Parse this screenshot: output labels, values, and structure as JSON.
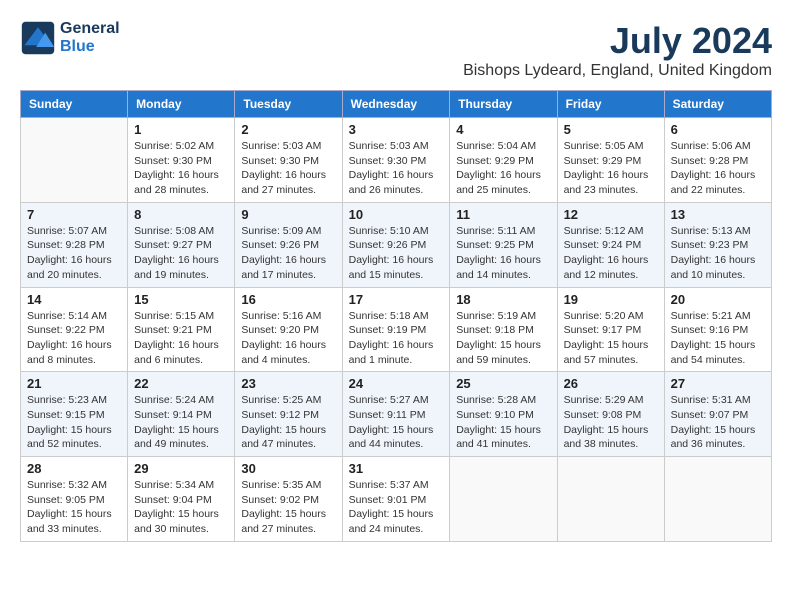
{
  "header": {
    "logo_line1": "General",
    "logo_line2": "Blue",
    "main_title": "July 2024",
    "subtitle": "Bishops Lydeard, England, United Kingdom"
  },
  "days_of_week": [
    "Sunday",
    "Monday",
    "Tuesday",
    "Wednesday",
    "Thursday",
    "Friday",
    "Saturday"
  ],
  "weeks": [
    [
      {
        "day": "",
        "info": ""
      },
      {
        "day": "1",
        "info": "Sunrise: 5:02 AM\nSunset: 9:30 PM\nDaylight: 16 hours\nand 28 minutes."
      },
      {
        "day": "2",
        "info": "Sunrise: 5:03 AM\nSunset: 9:30 PM\nDaylight: 16 hours\nand 27 minutes."
      },
      {
        "day": "3",
        "info": "Sunrise: 5:03 AM\nSunset: 9:30 PM\nDaylight: 16 hours\nand 26 minutes."
      },
      {
        "day": "4",
        "info": "Sunrise: 5:04 AM\nSunset: 9:29 PM\nDaylight: 16 hours\nand 25 minutes."
      },
      {
        "day": "5",
        "info": "Sunrise: 5:05 AM\nSunset: 9:29 PM\nDaylight: 16 hours\nand 23 minutes."
      },
      {
        "day": "6",
        "info": "Sunrise: 5:06 AM\nSunset: 9:28 PM\nDaylight: 16 hours\nand 22 minutes."
      }
    ],
    [
      {
        "day": "7",
        "info": "Sunrise: 5:07 AM\nSunset: 9:28 PM\nDaylight: 16 hours\nand 20 minutes."
      },
      {
        "day": "8",
        "info": "Sunrise: 5:08 AM\nSunset: 9:27 PM\nDaylight: 16 hours\nand 19 minutes."
      },
      {
        "day": "9",
        "info": "Sunrise: 5:09 AM\nSunset: 9:26 PM\nDaylight: 16 hours\nand 17 minutes."
      },
      {
        "day": "10",
        "info": "Sunrise: 5:10 AM\nSunset: 9:26 PM\nDaylight: 16 hours\nand 15 minutes."
      },
      {
        "day": "11",
        "info": "Sunrise: 5:11 AM\nSunset: 9:25 PM\nDaylight: 16 hours\nand 14 minutes."
      },
      {
        "day": "12",
        "info": "Sunrise: 5:12 AM\nSunset: 9:24 PM\nDaylight: 16 hours\nand 12 minutes."
      },
      {
        "day": "13",
        "info": "Sunrise: 5:13 AM\nSunset: 9:23 PM\nDaylight: 16 hours\nand 10 minutes."
      }
    ],
    [
      {
        "day": "14",
        "info": "Sunrise: 5:14 AM\nSunset: 9:22 PM\nDaylight: 16 hours\nand 8 minutes."
      },
      {
        "day": "15",
        "info": "Sunrise: 5:15 AM\nSunset: 9:21 PM\nDaylight: 16 hours\nand 6 minutes."
      },
      {
        "day": "16",
        "info": "Sunrise: 5:16 AM\nSunset: 9:20 PM\nDaylight: 16 hours\nand 4 minutes."
      },
      {
        "day": "17",
        "info": "Sunrise: 5:18 AM\nSunset: 9:19 PM\nDaylight: 16 hours\nand 1 minute."
      },
      {
        "day": "18",
        "info": "Sunrise: 5:19 AM\nSunset: 9:18 PM\nDaylight: 15 hours\nand 59 minutes."
      },
      {
        "day": "19",
        "info": "Sunrise: 5:20 AM\nSunset: 9:17 PM\nDaylight: 15 hours\nand 57 minutes."
      },
      {
        "day": "20",
        "info": "Sunrise: 5:21 AM\nSunset: 9:16 PM\nDaylight: 15 hours\nand 54 minutes."
      }
    ],
    [
      {
        "day": "21",
        "info": "Sunrise: 5:23 AM\nSunset: 9:15 PM\nDaylight: 15 hours\nand 52 minutes."
      },
      {
        "day": "22",
        "info": "Sunrise: 5:24 AM\nSunset: 9:14 PM\nDaylight: 15 hours\nand 49 minutes."
      },
      {
        "day": "23",
        "info": "Sunrise: 5:25 AM\nSunset: 9:12 PM\nDaylight: 15 hours\nand 47 minutes."
      },
      {
        "day": "24",
        "info": "Sunrise: 5:27 AM\nSunset: 9:11 PM\nDaylight: 15 hours\nand 44 minutes."
      },
      {
        "day": "25",
        "info": "Sunrise: 5:28 AM\nSunset: 9:10 PM\nDaylight: 15 hours\nand 41 minutes."
      },
      {
        "day": "26",
        "info": "Sunrise: 5:29 AM\nSunset: 9:08 PM\nDaylight: 15 hours\nand 38 minutes."
      },
      {
        "day": "27",
        "info": "Sunrise: 5:31 AM\nSunset: 9:07 PM\nDaylight: 15 hours\nand 36 minutes."
      }
    ],
    [
      {
        "day": "28",
        "info": "Sunrise: 5:32 AM\nSunset: 9:05 PM\nDaylight: 15 hours\nand 33 minutes."
      },
      {
        "day": "29",
        "info": "Sunrise: 5:34 AM\nSunset: 9:04 PM\nDaylight: 15 hours\nand 30 minutes."
      },
      {
        "day": "30",
        "info": "Sunrise: 5:35 AM\nSunset: 9:02 PM\nDaylight: 15 hours\nand 27 minutes."
      },
      {
        "day": "31",
        "info": "Sunrise: 5:37 AM\nSunset: 9:01 PM\nDaylight: 15 hours\nand 24 minutes."
      },
      {
        "day": "",
        "info": ""
      },
      {
        "day": "",
        "info": ""
      },
      {
        "day": "",
        "info": ""
      }
    ]
  ]
}
